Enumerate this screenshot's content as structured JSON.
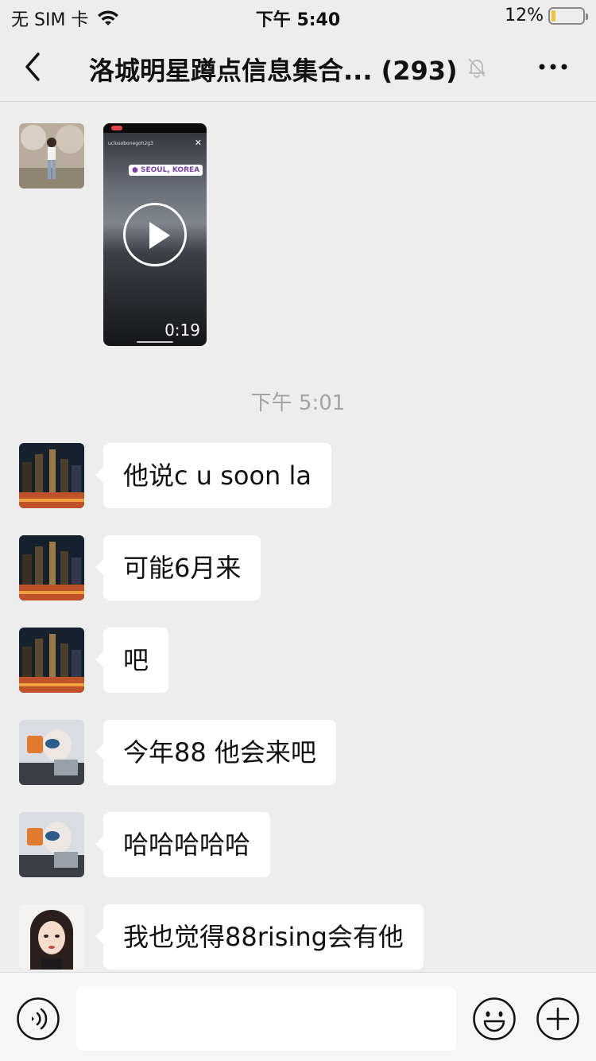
{
  "status_bar": {
    "carrier": "无 SIM 卡",
    "time": "下午 5:40",
    "battery_percent": "12%",
    "battery_level": 0.12,
    "battery_color": "#f2c230"
  },
  "nav": {
    "back_icon": "chevron-left-icon",
    "title": "洛城明星蹲点信息集合...",
    "member_count": "(293)",
    "mute_icon": "bell-slash-icon",
    "more_icon": "ellipsis-icon"
  },
  "video_message": {
    "location_tag": "● SEOUL, KOREA",
    "account": "uclosobonegoh2g3",
    "duration": "0:19"
  },
  "timestamp": "下午 5:01",
  "messages": [
    {
      "text": "他说c u soon la",
      "avatar": "city-night"
    },
    {
      "text": "可能6月来",
      "avatar": "city-night"
    },
    {
      "text": "吧",
      "avatar": "city-night"
    },
    {
      "text": "今年88 他会来吧",
      "avatar": "girl-car"
    },
    {
      "text": "哈哈哈哈哈",
      "avatar": "girl-car"
    },
    {
      "text": "我也觉得88rising会有他",
      "avatar": "illustrated-girl"
    }
  ],
  "input_bar": {
    "voice_icon": "voice-wave-icon",
    "input_value": "",
    "emoji_icon": "smiley-icon",
    "plus_icon": "plus-circle-icon"
  },
  "colors": {
    "background": "#ededed",
    "bubble": "#ffffff",
    "timestamp": "#a3a3a3"
  }
}
